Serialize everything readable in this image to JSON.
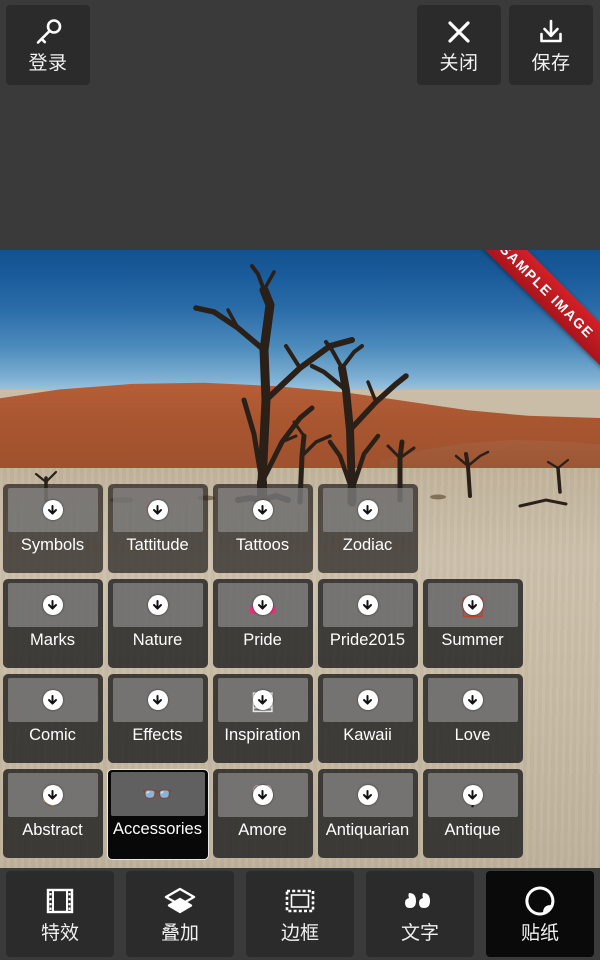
{
  "topbar": {
    "buttons": [
      {
        "id": "login",
        "label": "登录",
        "icon": "key-icon"
      },
      {
        "id": "close",
        "label": "关闭",
        "icon": "close-icon"
      },
      {
        "id": "save",
        "label": "保存",
        "icon": "download-icon"
      }
    ]
  },
  "photo": {
    "watermark": "SAMPLE IMAGE",
    "description": "desert-dead-trees-photo",
    "colors": {
      "sky_top": "#14528f",
      "sky_horizon": "#9cc3dc",
      "dune": "#b9603a",
      "sand": "#c9bca6",
      "ribbon": "#d42027"
    }
  },
  "sticker_grid": {
    "badge_icon": "download-badge-icon",
    "rows": [
      {
        "partial": true,
        "items": [
          {
            "label": "Symbols",
            "art": "♣",
            "art_color": "#2e4d63",
            "needs_download": true,
            "selected": false
          },
          {
            "label": "Tattitude",
            "art": "❤",
            "art_color": "#b03a3a",
            "needs_download": true,
            "selected": false
          },
          {
            "label": "Tattoos",
            "art": "★",
            "art_color": "#101010",
            "needs_download": true,
            "selected": false
          },
          {
            "label": "Zodiac",
            "art": "♒",
            "art_color": "#5c8fc4",
            "needs_download": true,
            "selected": false
          }
        ]
      },
      {
        "partial": false,
        "items": [
          {
            "label": "Marks",
            "art": "❥",
            "art_color": "#a52a2a",
            "needs_download": true,
            "selected": false
          },
          {
            "label": "Nature",
            "art": "✿",
            "art_color": "#c8a04a",
            "needs_download": true,
            "selected": false
          },
          {
            "label": "Pride",
            "art": "▬",
            "art_color": "#d43a7a",
            "needs_download": true,
            "selected": false
          },
          {
            "label": "Pride2015",
            "art": "♥",
            "art_color": "#e0a030",
            "needs_download": true,
            "selected": false
          },
          {
            "label": "Summer",
            "art": "▣",
            "art_color": "#cf3b2c",
            "needs_download": true,
            "selected": false
          }
        ]
      },
      {
        "partial": false,
        "items": [
          {
            "label": "Comic",
            "art": "✦",
            "art_color": "#3f7a3a",
            "needs_download": true,
            "selected": false
          },
          {
            "label": "Effects",
            "art": "✺",
            "art_color": "#2f7fd0",
            "needs_download": true,
            "selected": false
          },
          {
            "label": "Inspiration",
            "art": "▤",
            "art_color": "#e8e8e8",
            "needs_download": true,
            "selected": false
          },
          {
            "label": "Kawaii",
            "art": "✾",
            "art_color": "#c98a4b",
            "needs_download": true,
            "selected": false
          },
          {
            "label": "Love",
            "art": "❀",
            "art_color": "#c2477e",
            "needs_download": true,
            "selected": false
          }
        ]
      },
      {
        "partial": false,
        "items": [
          {
            "label": "Abstract",
            "art": "⬡",
            "art_color": "#c8a14a",
            "needs_download": true,
            "selected": false
          },
          {
            "label": "Accessories",
            "art": "👓",
            "art_color": "#2f9c3f",
            "needs_download": false,
            "selected": true
          },
          {
            "label": "Amore",
            "art": "♡",
            "art_color": "#eeb7c4",
            "needs_download": true,
            "selected": false
          },
          {
            "label": "Antiquarian",
            "art": "✒",
            "art_color": "#141414",
            "needs_download": true,
            "selected": false
          },
          {
            "label": "Antique",
            "art": "⚲",
            "art_color": "#1c1c1c",
            "needs_download": true,
            "selected": false
          }
        ]
      }
    ]
  },
  "bottom_nav": {
    "items": [
      {
        "label": "特效",
        "icon": "film-icon",
        "active": false
      },
      {
        "label": "叠加",
        "icon": "layers-icon",
        "active": false
      },
      {
        "label": "边框",
        "icon": "frame-icon",
        "active": false
      },
      {
        "label": "文字",
        "icon": "quotes-icon",
        "active": false
      },
      {
        "label": "贴纸",
        "icon": "sticker-icon",
        "active": true
      }
    ]
  }
}
